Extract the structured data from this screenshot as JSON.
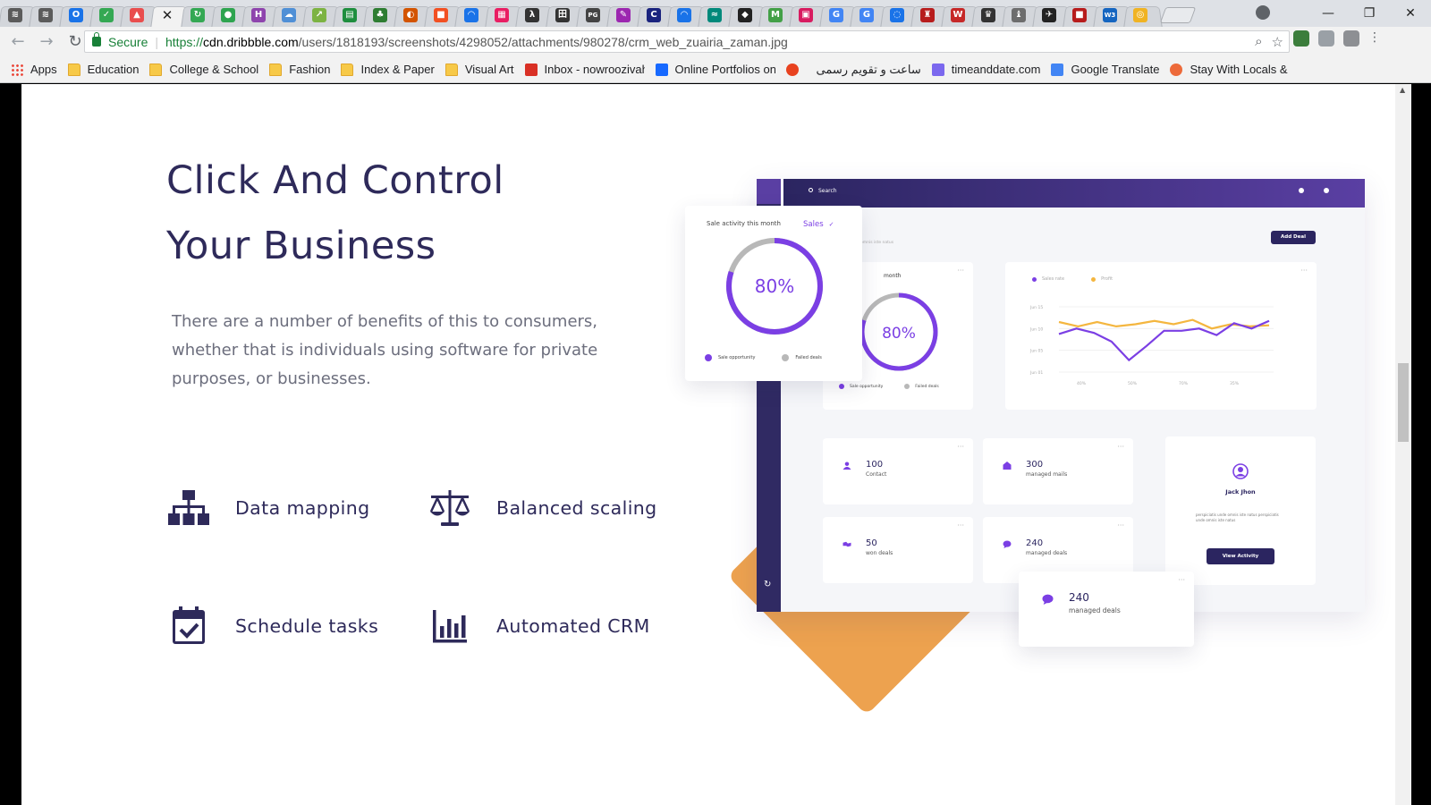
{
  "browser": {
    "active_tab_close": "✕",
    "tabs": [
      {
        "icon": "grid-icon",
        "color": "#5b5b5b",
        "glyph": "≋"
      },
      {
        "icon": "grid-icon",
        "color": "#5b5b5b",
        "glyph": "≋"
      },
      {
        "icon": "outlook-icon",
        "color": "#1a73e8",
        "glyph": "O"
      },
      {
        "icon": "leaf-icon",
        "color": "#34a853",
        "glyph": "✓"
      },
      {
        "icon": "chart-icon",
        "color": "#e94e4e",
        "glyph": "▲"
      },
      {
        "icon": "close-icon",
        "color": "#f2f2f2",
        "glyph": "✕",
        "active": true
      },
      {
        "icon": "refresh-icon",
        "color": "#34a853",
        "glyph": "↻"
      },
      {
        "icon": "globe-icon",
        "color": "#2ea44f",
        "glyph": "●"
      },
      {
        "icon": "h-icon",
        "color": "#8e44ad",
        "glyph": "H"
      },
      {
        "icon": "cloud-icon",
        "color": "#4f8fd6",
        "glyph": "☁"
      },
      {
        "icon": "chart-line-icon",
        "color": "#7cb342",
        "glyph": "↗"
      },
      {
        "icon": "doc-icon",
        "color": "#1e8e3e",
        "glyph": "▤"
      },
      {
        "icon": "tree-icon",
        "color": "#2e7d32",
        "glyph": "♣"
      },
      {
        "icon": "circle-icon",
        "color": "#d35400",
        "glyph": "◐"
      },
      {
        "icon": "windows-icon",
        "color": "#f25022",
        "glyph": "■"
      },
      {
        "icon": "loading-icon",
        "color": "#1a73e8",
        "glyph": "◠"
      },
      {
        "icon": "apps-icon",
        "color": "#e91e63",
        "glyph": "▦"
      },
      {
        "icon": "lambda-icon",
        "color": "#333333",
        "glyph": "λ"
      },
      {
        "icon": "text-icon",
        "color": "#333333",
        "glyph": "田"
      },
      {
        "icon": "pg-icon",
        "color": "#444444",
        "glyph": "PG"
      },
      {
        "icon": "pen-icon",
        "color": "#9c27b0",
        "glyph": "✎"
      },
      {
        "icon": "c-icon",
        "color": "#1a237e",
        "glyph": "C"
      },
      {
        "icon": "loading-icon",
        "color": "#1a73e8",
        "glyph": "◠"
      },
      {
        "icon": "wave-icon",
        "color": "#00897b",
        "glyph": "≈"
      },
      {
        "icon": "bookmark-icon",
        "color": "#222222",
        "glyph": "◆"
      },
      {
        "icon": "m-icon",
        "color": "#43a047",
        "glyph": "M"
      },
      {
        "icon": "square-icon",
        "color": "#d81b60",
        "glyph": "▣"
      },
      {
        "icon": "google-icon",
        "color": "#4285f4",
        "glyph": "G"
      },
      {
        "icon": "google-icon",
        "color": "#4285f4",
        "glyph": "G"
      },
      {
        "icon": "loading-icon",
        "color": "#1a73e8",
        "glyph": "◌"
      },
      {
        "icon": "crest-icon",
        "color": "#b71c1c",
        "glyph": "♜"
      },
      {
        "icon": "shield-icon",
        "color": "#c62828",
        "glyph": "W"
      },
      {
        "icon": "shield-icon",
        "color": "#333333",
        "glyph": "♛"
      },
      {
        "icon": "crest-icon",
        "color": "#6d6d6d",
        "glyph": "♝"
      },
      {
        "icon": "bird-icon",
        "color": "#222222",
        "glyph": "✈"
      },
      {
        "icon": "shield-icon",
        "color": "#b71c1c",
        "glyph": "■"
      },
      {
        "icon": "w3-icon",
        "color": "#1565c0",
        "glyph": "W3"
      },
      {
        "icon": "circle-icon",
        "color": "#f0b323",
        "glyph": "◎"
      }
    ],
    "window_controls": [
      "—",
      "❐",
      "✕"
    ],
    "back": "←",
    "forward": "→",
    "reload": "↻",
    "secure_label": "Secure",
    "url_scheme": "https://",
    "url_host": "cdn.dribbble.com",
    "url_path": "/users/1818193/screenshots/4298052/attachments/980278/crm_web_zuairia_zaman.jpg",
    "omnibox_icons": [
      "⌕",
      "☆"
    ],
    "bookmarks": [
      {
        "label": "Apps",
        "icon": "apps-grid-icon",
        "color": "#4285f4",
        "type": "apps"
      },
      {
        "label": "Education",
        "icon": "folder-icon",
        "type": "folder"
      },
      {
        "label": "College & School",
        "icon": "folder-icon",
        "type": "folder"
      },
      {
        "label": "Fashion",
        "icon": "folder-icon",
        "type": "folder"
      },
      {
        "label": "Index & Paper",
        "icon": "folder-icon",
        "type": "folder"
      },
      {
        "label": "Visual Art",
        "icon": "folder-icon",
        "type": "folder"
      },
      {
        "label": "Inbox - nowroozivahi",
        "icon": "gmail-icon",
        "color": "#d93025",
        "type": "site"
      },
      {
        "label": "Online Portfolios on",
        "icon": "behance-icon",
        "color": "#1769ff",
        "type": "site"
      },
      {
        "label": "",
        "icon": "t-icon",
        "color": "#e8421f",
        "type": "site"
      },
      {
        "label": "ساعت و تقویم رسمی",
        "icon": "",
        "type": "text"
      },
      {
        "label": "timeanddate.com",
        "icon": "dots-icon",
        "color": "#7b68ee",
        "type": "site"
      },
      {
        "label": "Google Translate",
        "icon": "translate-icon",
        "color": "#4285f4",
        "type": "site"
      },
      {
        "label": "Stay With Locals & M",
        "icon": "couchsurfing-icon",
        "color": "#ed6a3a",
        "type": "site"
      }
    ]
  },
  "hero": {
    "title_line1": "Click And Control",
    "title_line2": "Your Business",
    "description": "There are a number of benefits of this to consumers, whether that is individuals using software for private purposes, or businesses."
  },
  "features": [
    {
      "label": "Data mapping",
      "icon": "sitemap-icon"
    },
    {
      "label": "Balanced scaling",
      "icon": "scale-icon"
    },
    {
      "label": "Schedule tasks",
      "icon": "calendar-check-icon"
    },
    {
      "label": "Automated CRM",
      "icon": "bar-chart-icon"
    }
  ],
  "dashboard": {
    "search": "Search",
    "add_deal": "Add Deal",
    "desc_snippet": "perspiciatis unde omnis iste natus",
    "donut_card_title": "month",
    "donut_value": "80%",
    "donut_percent": 80,
    "legend_opportunity": "Sale opportunity",
    "legend_failed": "Failed deals",
    "line_legend": [
      "Sales rate",
      "Profit"
    ],
    "line_y_labels": [
      "Jun 15",
      "Jun 10",
      "Jun 05",
      "Jun 01"
    ],
    "line_x_labels": [
      "40%",
      "50%",
      "70%",
      "35%"
    ],
    "stats": [
      {
        "value": "100",
        "label": "Contact",
        "icon": "user-icon"
      },
      {
        "value": "300",
        "label": "managed mails",
        "icon": "mail-icon"
      },
      {
        "value": "50",
        "label": "won deals",
        "icon": "handshake-icon"
      },
      {
        "value": "240",
        "label": "managed deals",
        "icon": "chat-icon"
      }
    ],
    "profile_name": "Jack Jhon",
    "profile_desc": "perspiciatis unde omnis iste natus perspiciatis unde omnis iste natus",
    "view_activity": "View Activity"
  },
  "popup_sale": {
    "title": "Sale activity this month",
    "dropdown": "Sales",
    "value": "80%",
    "percent": 80,
    "legend_opportunity": "Sale opportunity",
    "legend_failed": "Failed deals"
  },
  "popup_deals": {
    "value": "240",
    "label": "managed deals"
  },
  "colors": {
    "purple": "#7b3fe4",
    "navy": "#2e2a5a",
    "orange": "#eda24f",
    "yellow": "#f4b63f",
    "grey_ring": "#b8b8b8"
  },
  "chart_data": {
    "type": "line",
    "x": [
      "40%",
      "50%",
      "70%",
      "35%"
    ],
    "y_tick_labels": [
      "Jun 01",
      "Jun 05",
      "Jun 10",
      "Jun 15"
    ],
    "series": [
      {
        "name": "Sales rate",
        "values": [
          1.75,
          2.0,
          1.8,
          1.4,
          0.55,
          1.2,
          1.9,
          1.9,
          2.0,
          1.7,
          2.25,
          2.0,
          2.35
        ]
      },
      {
        "name": "Profit",
        "values": [
          2.3,
          2.1,
          2.3,
          2.1,
          2.2,
          2.35,
          2.2,
          2.4,
          2.0,
          2.2,
          2.1,
          2.15
        ]
      }
    ]
  }
}
